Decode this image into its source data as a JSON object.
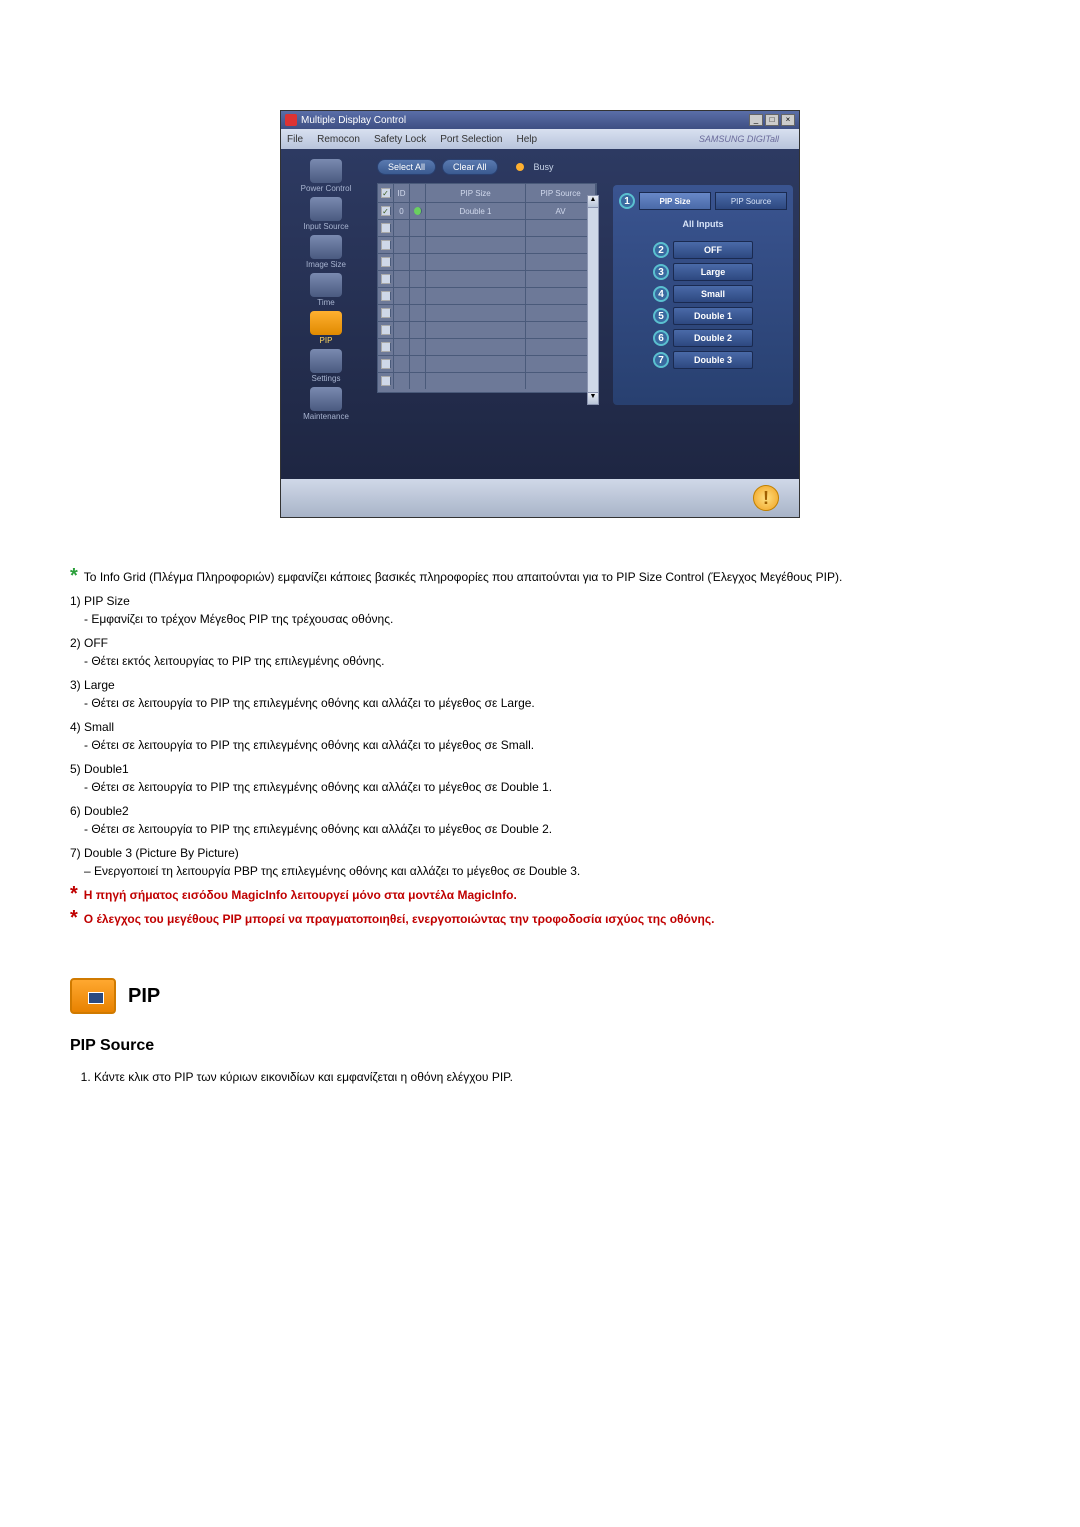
{
  "window": {
    "title": "Multiple Display Control",
    "menu": [
      "File",
      "Remocon",
      "Safety Lock",
      "Port Selection",
      "Help"
    ],
    "brand": "SAMSUNG DIGITall"
  },
  "sidebar": {
    "items": [
      {
        "label": "Power Control"
      },
      {
        "label": "Input Source"
      },
      {
        "label": "Image Size"
      },
      {
        "label": "Time"
      },
      {
        "label": "PIP"
      },
      {
        "label": "Settings"
      },
      {
        "label": "Maintenance"
      }
    ]
  },
  "toolbar": {
    "select_all": "Select All",
    "clear_all": "Clear All",
    "busy": "Busy"
  },
  "grid": {
    "headers": {
      "id": "ID",
      "pip_size": "PIP Size",
      "pip_source": "PIP Source"
    },
    "rows": [
      {
        "checked": true,
        "id": "0",
        "pip_size": "Double 1",
        "pip_source": "AV"
      },
      {
        "checked": false
      },
      {
        "checked": false
      },
      {
        "checked": false
      },
      {
        "checked": false
      },
      {
        "checked": false
      },
      {
        "checked": false
      },
      {
        "checked": false
      },
      {
        "checked": false
      },
      {
        "checked": false
      },
      {
        "checked": false
      }
    ]
  },
  "panel": {
    "tabs": [
      "PIP Size",
      "PIP Source"
    ],
    "subhead": "All Inputs",
    "options": [
      "OFF",
      "Large",
      "Small",
      "Double 1",
      "Double 2",
      "Double 3"
    ]
  },
  "callouts": [
    "1",
    "2",
    "3",
    "4",
    "5",
    "6",
    "7"
  ],
  "doc": {
    "intro": "Το Info Grid (Πλέγμα Πληροφοριών) εμφανίζει κάποιες βασικές πληροφορίες που απαιτούνται για το PIP Size Control (Έλεγχος Μεγέθους PIP).",
    "items": [
      {
        "num": "1)",
        "title": "PIP Size",
        "desc": "- Εμφανίζει το τρέχον Μέγεθος PIP της τρέχουσας οθόνης."
      },
      {
        "num": "2)",
        "title": "OFF",
        "desc": "- Θέτει εκτός λειτουργίας το PIP της επιλεγμένης οθόνης."
      },
      {
        "num": "3)",
        "title": "Large",
        "desc": "- Θέτει σε λειτουργία το PIP της επιλεγμένης οθόνης και αλλάζει το μέγεθος σε Large."
      },
      {
        "num": "4)",
        "title": "Small",
        "desc": "- Θέτει σε λειτουργία το PIP της επιλεγμένης οθόνης και αλλάζει το μέγεθος σε Small."
      },
      {
        "num": "5)",
        "title": "Double1",
        "desc": "- Θέτει σε λειτουργία το PIP της επιλεγμένης οθόνης και αλλάζει το μέγεθος σε Double 1."
      },
      {
        "num": "6)",
        "title": "Double2",
        "desc": "- Θέτει σε λειτουργία το PIP της επιλεγμένης οθόνης και αλλάζει το μέγεθος σε Double 2."
      },
      {
        "num": "7)",
        "title": "Double 3 (Picture By Picture)",
        "desc": "– Ενεργοποιεί τη λειτουργία PBP της επιλεγμένης οθόνης και αλλάζει το μέγεθος σε Double 3."
      }
    ],
    "note1": "Η πηγή σήματος εισόδου MagicInfo λειτουργεί μόνο στα μοντέλα MagicInfo.",
    "note2": "Ο έλεγχος του μεγέθους PIP μπορεί να πραγματοποιηθεί, ενεργοποιώντας την τροφοδοσία ισχύος της οθόνης.",
    "section_title": "PIP",
    "sub_section": "PIP Source",
    "step1": "Κάντε κλικ στο PIP των κύριων εικονιδίων και εμφανίζεται η οθόνη ελέγχου PIP."
  }
}
